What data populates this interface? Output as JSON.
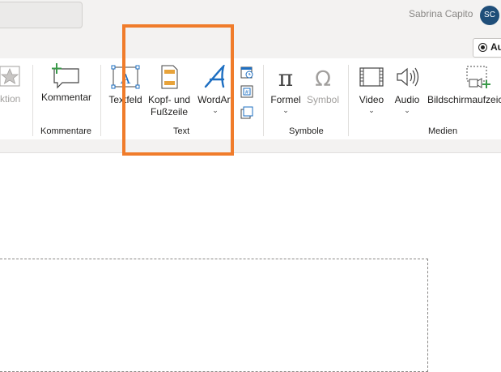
{
  "titlebar": {
    "user_name": "Sabrina Capito",
    "avatar_initials": "SC",
    "autosave_label": "Au"
  },
  "ribbon": {
    "partial_left_label": "ktion",
    "groups": {
      "kommentare": {
        "label": "Kommentare",
        "buttons": {
          "kommentar": "Kommentar"
        }
      },
      "text": {
        "label": "Text",
        "buttons": {
          "textfeld": "Textfeld",
          "kopf_fusszeile_line1": "Kopf- und",
          "kopf_fusszeile_line2": "Fußzeile",
          "wordart": "WordArt"
        }
      },
      "symbole": {
        "label": "Symbole",
        "buttons": {
          "formel": "Formel",
          "symbol": "Symbol"
        }
      },
      "medien": {
        "label": "Medien",
        "buttons": {
          "video": "Video",
          "audio": "Audio",
          "bildschirmaufzeichnung": "Bildschirmaufzeic"
        }
      }
    },
    "chevron": "⌄"
  },
  "colors": {
    "highlight": "#f07c2b",
    "avatar": "#1f4e79",
    "accent_green": "#3a9a4a",
    "accent_blue": "#1e6fc2",
    "accent_orange": "#e8a33a"
  }
}
